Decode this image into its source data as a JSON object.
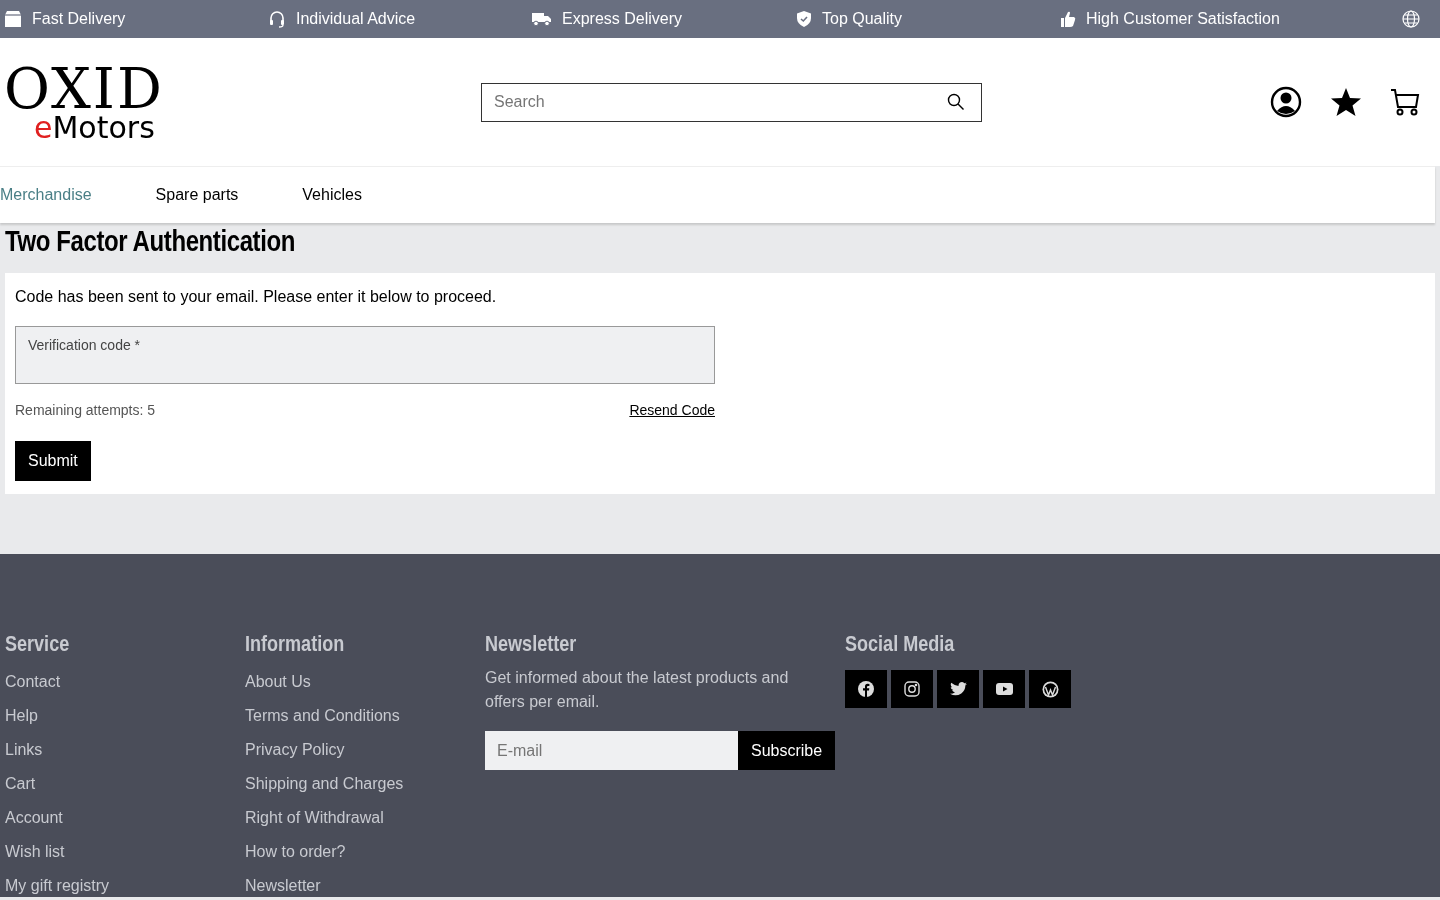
{
  "top_bar": {
    "features": [
      {
        "kind": "box",
        "label": "Fast Delivery"
      },
      {
        "kind": "headset",
        "label": "Individual Advice"
      },
      {
        "kind": "truck",
        "label": "Express Delivery"
      },
      {
        "kind": "shield",
        "label": "Top Quality"
      },
      {
        "kind": "thumb",
        "label": "High Customer Satisfaction"
      }
    ]
  },
  "header": {
    "logo": {
      "top": "OXID",
      "accent": "e",
      "rest": "Motors"
    },
    "search": {
      "placeholder": "Search"
    }
  },
  "nav": [
    {
      "label": "Merchandise",
      "selected": true
    },
    {
      "label": "Spare parts",
      "selected": false
    },
    {
      "label": "Vehicles",
      "selected": false
    }
  ],
  "page": {
    "title": "Two Factor Authentication",
    "message": "Code has been sent to your email. Please enter it below to proceed.",
    "field_label": "Verification code *",
    "attempts": "Remaining attempts: 5",
    "resend": "Resend Code",
    "submit": "Submit"
  },
  "footer": {
    "columns": [
      {
        "title": "Service",
        "links": [
          "Contact",
          "Help",
          "Links",
          "Cart",
          "Account",
          "Wish list",
          "My gift registry"
        ]
      },
      {
        "title": "Information",
        "links": [
          "About Us",
          "Terms and Conditions",
          "Privacy Policy",
          "Shipping and Charges",
          "Right of Withdrawal",
          "How to order?",
          "Newsletter"
        ]
      }
    ],
    "newsletter": {
      "title": "Newsletter",
      "text": "Get informed about the latest products and offers per email.",
      "placeholder": "E-mail",
      "button": "Subscribe"
    },
    "social": {
      "title": "Social Media",
      "items": [
        {
          "kind": "facebook"
        },
        {
          "kind": "instagram"
        },
        {
          "kind": "twitter"
        },
        {
          "kind": "youtube"
        },
        {
          "kind": "wordpress"
        }
      ]
    }
  }
}
